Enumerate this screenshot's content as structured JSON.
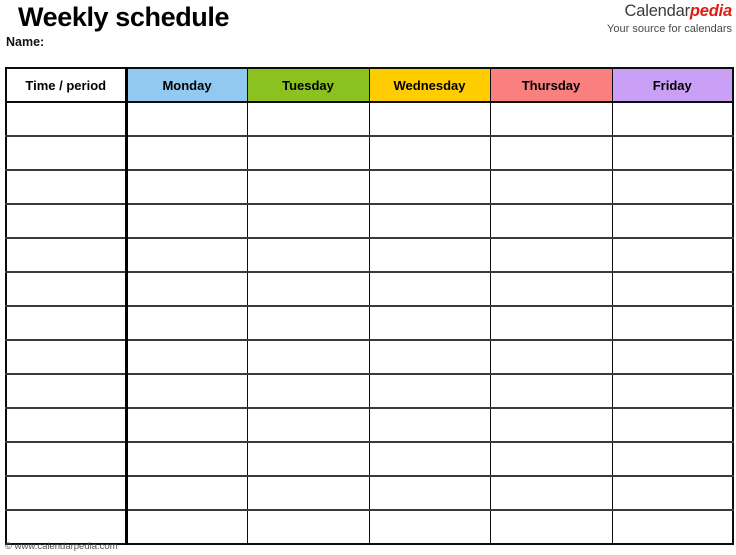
{
  "document": {
    "title": "Weekly schedule",
    "name_label": "Name:"
  },
  "brand": {
    "name_primary": "Calendar",
    "name_accent": "pedia",
    "tagline": "Your source for calendars",
    "accent_color": "#e01b14",
    "primary_color": "#3b3b3b"
  },
  "table": {
    "columns": [
      {
        "label": "Time / period",
        "color": "#ffffff"
      },
      {
        "label": "Monday",
        "color": "#92c9f0"
      },
      {
        "label": "Tuesday",
        "color": "#8cc220"
      },
      {
        "label": "Wednesday",
        "color": "#ffcc00"
      },
      {
        "label": "Thursday",
        "color": "#fa8080"
      },
      {
        "label": "Friday",
        "color": "#c9a0f5"
      }
    ],
    "row_count": 13,
    "rows": [
      [
        "",
        "",
        "",
        "",
        "",
        ""
      ],
      [
        "",
        "",
        "",
        "",
        "",
        ""
      ],
      [
        "",
        "",
        "",
        "",
        "",
        ""
      ],
      [
        "",
        "",
        "",
        "",
        "",
        ""
      ],
      [
        "",
        "",
        "",
        "",
        "",
        ""
      ],
      [
        "",
        "",
        "",
        "",
        "",
        ""
      ],
      [
        "",
        "",
        "",
        "",
        "",
        ""
      ],
      [
        "",
        "",
        "",
        "",
        "",
        ""
      ],
      [
        "",
        "",
        "",
        "",
        "",
        ""
      ],
      [
        "",
        "",
        "",
        "",
        "",
        ""
      ],
      [
        "",
        "",
        "",
        "",
        "",
        ""
      ],
      [
        "",
        "",
        "",
        "",
        "",
        ""
      ],
      [
        "",
        "",
        "",
        "",
        "",
        ""
      ]
    ]
  },
  "footer": {
    "credit": "© www.calendarpedia.com"
  }
}
